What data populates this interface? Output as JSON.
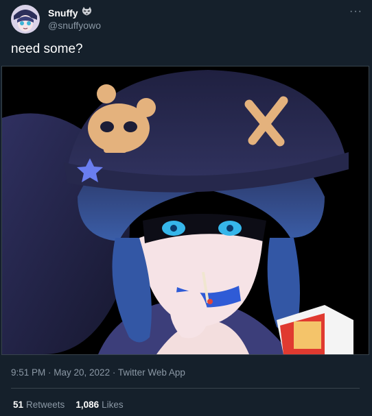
{
  "author": {
    "display_name": "Snuffy",
    "handle": "@snuffyowo",
    "badge_icon": "raccoon-icon"
  },
  "more_label": "···",
  "tweet": {
    "text": "need some?"
  },
  "meta": {
    "text": "9:51 PM · May 20, 2022 · Twitter Web App"
  },
  "stats": {
    "retweets_count": "51",
    "retweets_label": "Retweets",
    "likes_count": "1,086",
    "likes_label": "Likes"
  },
  "colors": {
    "background": "#15202b",
    "secondary_text": "#8b98a5",
    "border": "#38444d"
  }
}
